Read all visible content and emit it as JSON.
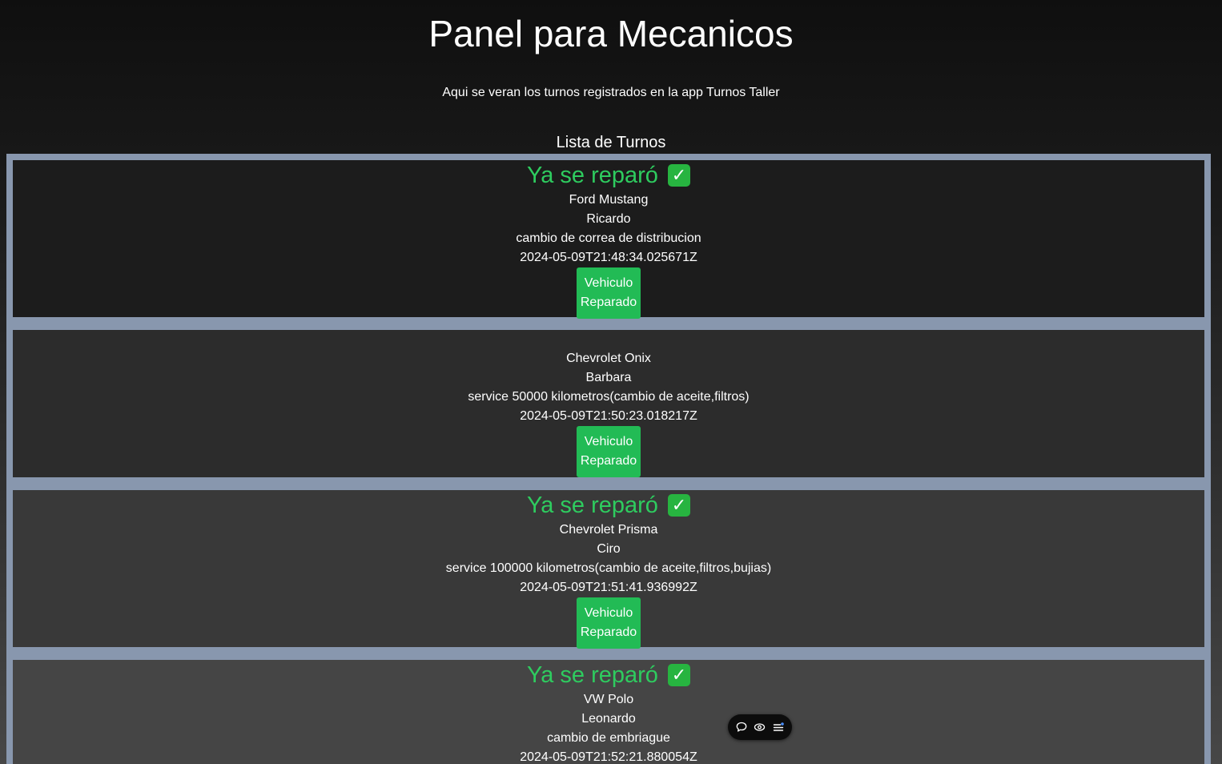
{
  "header": {
    "title": "Panel para Mecanicos",
    "subtitle": "Aqui se veran los turnos registrados en la app Turnos Taller",
    "list_heading": "Lista de Turnos"
  },
  "turnos": [
    {
      "status": "Ya se reparó",
      "check_icon": "✓",
      "vehicle": "Ford Mustang",
      "client": "Ricardo",
      "service": "cambio de correa de distribucion",
      "date": "2024-05-09T21:48:34.025671Z",
      "button_label": "Vehiculo Reparado"
    },
    {
      "status": "",
      "vehicle": "Chevrolet Onix",
      "client": "Barbara",
      "service": "service 50000 kilometros(cambio de aceite,filtros)",
      "date": "2024-05-09T21:50:23.018217Z",
      "button_label": "Vehiculo Reparado"
    },
    {
      "status": "Ya se reparó",
      "check_icon": "✓",
      "vehicle": "Chevrolet Prisma",
      "client": "Ciro",
      "service": "service 100000 kilometros(cambio de aceite,filtros,bujias)",
      "date": "2024-05-09T21:51:41.936992Z",
      "button_label": "Vehiculo Reparado"
    },
    {
      "status": "Ya se reparó",
      "check_icon": "✓",
      "vehicle": "VW Polo",
      "client": "Leonardo",
      "service": "cambio de embriague",
      "date": "2024-05-09T21:52:21.880054Z"
    }
  ],
  "colors": {
    "status_green": "#2ecc5f",
    "button_green": "#22bb55",
    "list_border": "#8897ae"
  },
  "toolbar": {
    "icons": [
      "comment-icon",
      "eye-icon",
      "menu-list-icon"
    ]
  }
}
